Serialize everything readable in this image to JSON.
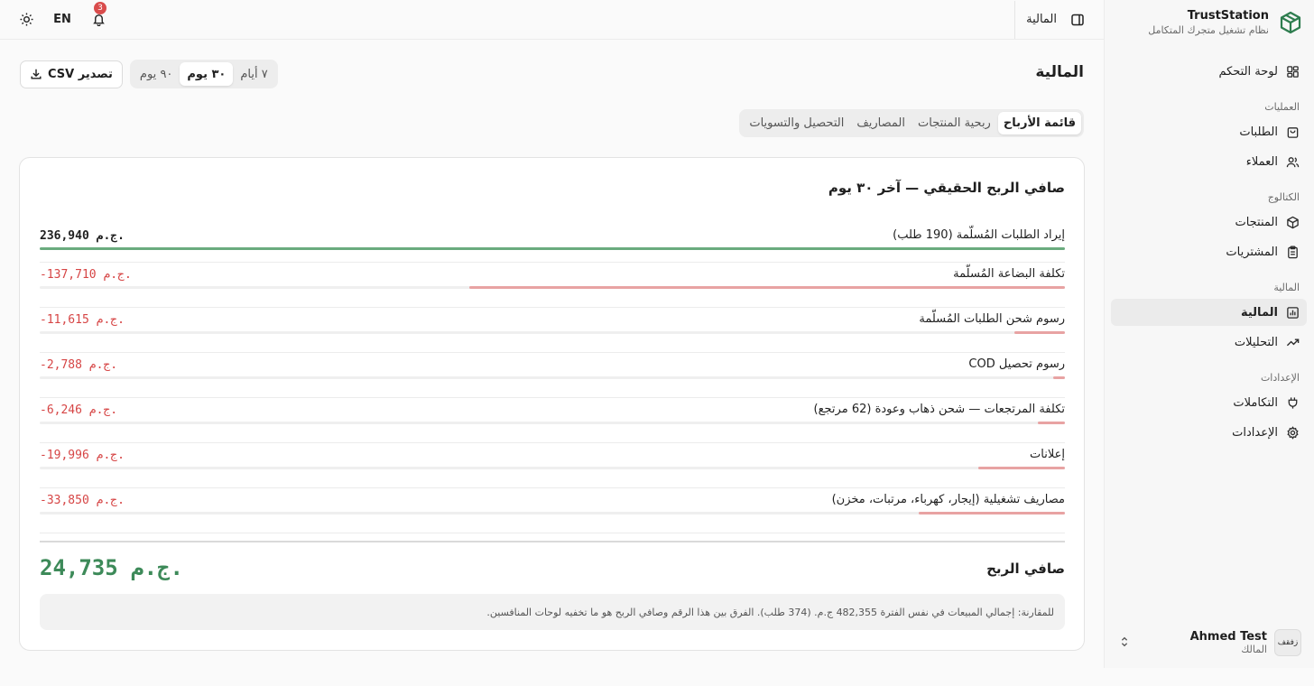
{
  "brand": {
    "name": "TrustStation",
    "subtitle": "نظام تشغيل متجرك المتكامل"
  },
  "sidebar": {
    "dashboard": "لوحة التحكم",
    "groups": {
      "operations": "العمليات",
      "catalog": "الكتالوج",
      "finance": "المالية",
      "settings": "الإعدادات"
    },
    "items": {
      "orders": "الطلبات",
      "customers": "العملاء",
      "products": "المنتجات",
      "purchases": "المشتريات",
      "finance": "المالية",
      "analytics": "التحليلات",
      "integrations": "التكاملات",
      "settings": "الإعدادات"
    }
  },
  "user": {
    "name": "Ahmed Test",
    "role": "المالك",
    "avatar_text": "زفقف"
  },
  "header": {
    "title": "المالية",
    "lang": "EN",
    "notifications": "3"
  },
  "page": {
    "title": "المالية"
  },
  "toolbar": {
    "export_label": "تصدير CSV",
    "ranges": [
      "٧ أيام",
      "٣٠ يوم",
      "٩٠ يوم"
    ],
    "active_range": 1
  },
  "tabs": [
    "قائمة الأرباح",
    "ربحية المنتجات",
    "المصاريف",
    "التحصيل والتسويات"
  ],
  "card": {
    "title": "صافي الربح الحقيقي — آخر ٣٠ يوم",
    "rows": [
      {
        "label": "إيراد الطلبات المُسلّمة (190 طلب)",
        "value": "236,940 ج.م.",
        "amount": 236940,
        "positive": true
      },
      {
        "label": "تكلفة البضاعة المُسلّمة",
        "value": "-137,710 ج.م.",
        "amount": 137710,
        "positive": false
      },
      {
        "label": "رسوم شحن الطلبات المُسلّمة",
        "value": "-11,615 ج.م.",
        "amount": 11615,
        "positive": false
      },
      {
        "label": "رسوم تحصيل COD",
        "value": "-2,788 ج.م.",
        "amount": 2788,
        "positive": false
      },
      {
        "label": "تكلفة المرتجعات — شحن ذهاب وعودة (62 مرتجع)",
        "value": "-6,246 ج.م.",
        "amount": 6246,
        "positive": false
      },
      {
        "label": "إعلانات",
        "value": "-19,996 ج.م.",
        "amount": 19996,
        "positive": false
      },
      {
        "label": "مصاريف تشغيلية (إيجار، كهرباء، مرتبات، مخزن)",
        "value": "-33,850 ج.م.",
        "amount": 33850,
        "positive": false
      }
    ],
    "net_label": "صافي الربح",
    "net_value": "24,735 ج.م.",
    "note": "للمقارنة: إجمالي المبيعات في نفس الفترة 482,355 ج.م. (374 طلب). الفرق بين هذا الرقم وصافي الربح هو ما تخفيه لوحات المنافسين."
  },
  "colors": {
    "accent": "#2e7d4f",
    "positive_bar": "#6aab7e",
    "negative": "#d64545",
    "negative_bar": "#e8a3a3",
    "net": "#3d8a59"
  }
}
